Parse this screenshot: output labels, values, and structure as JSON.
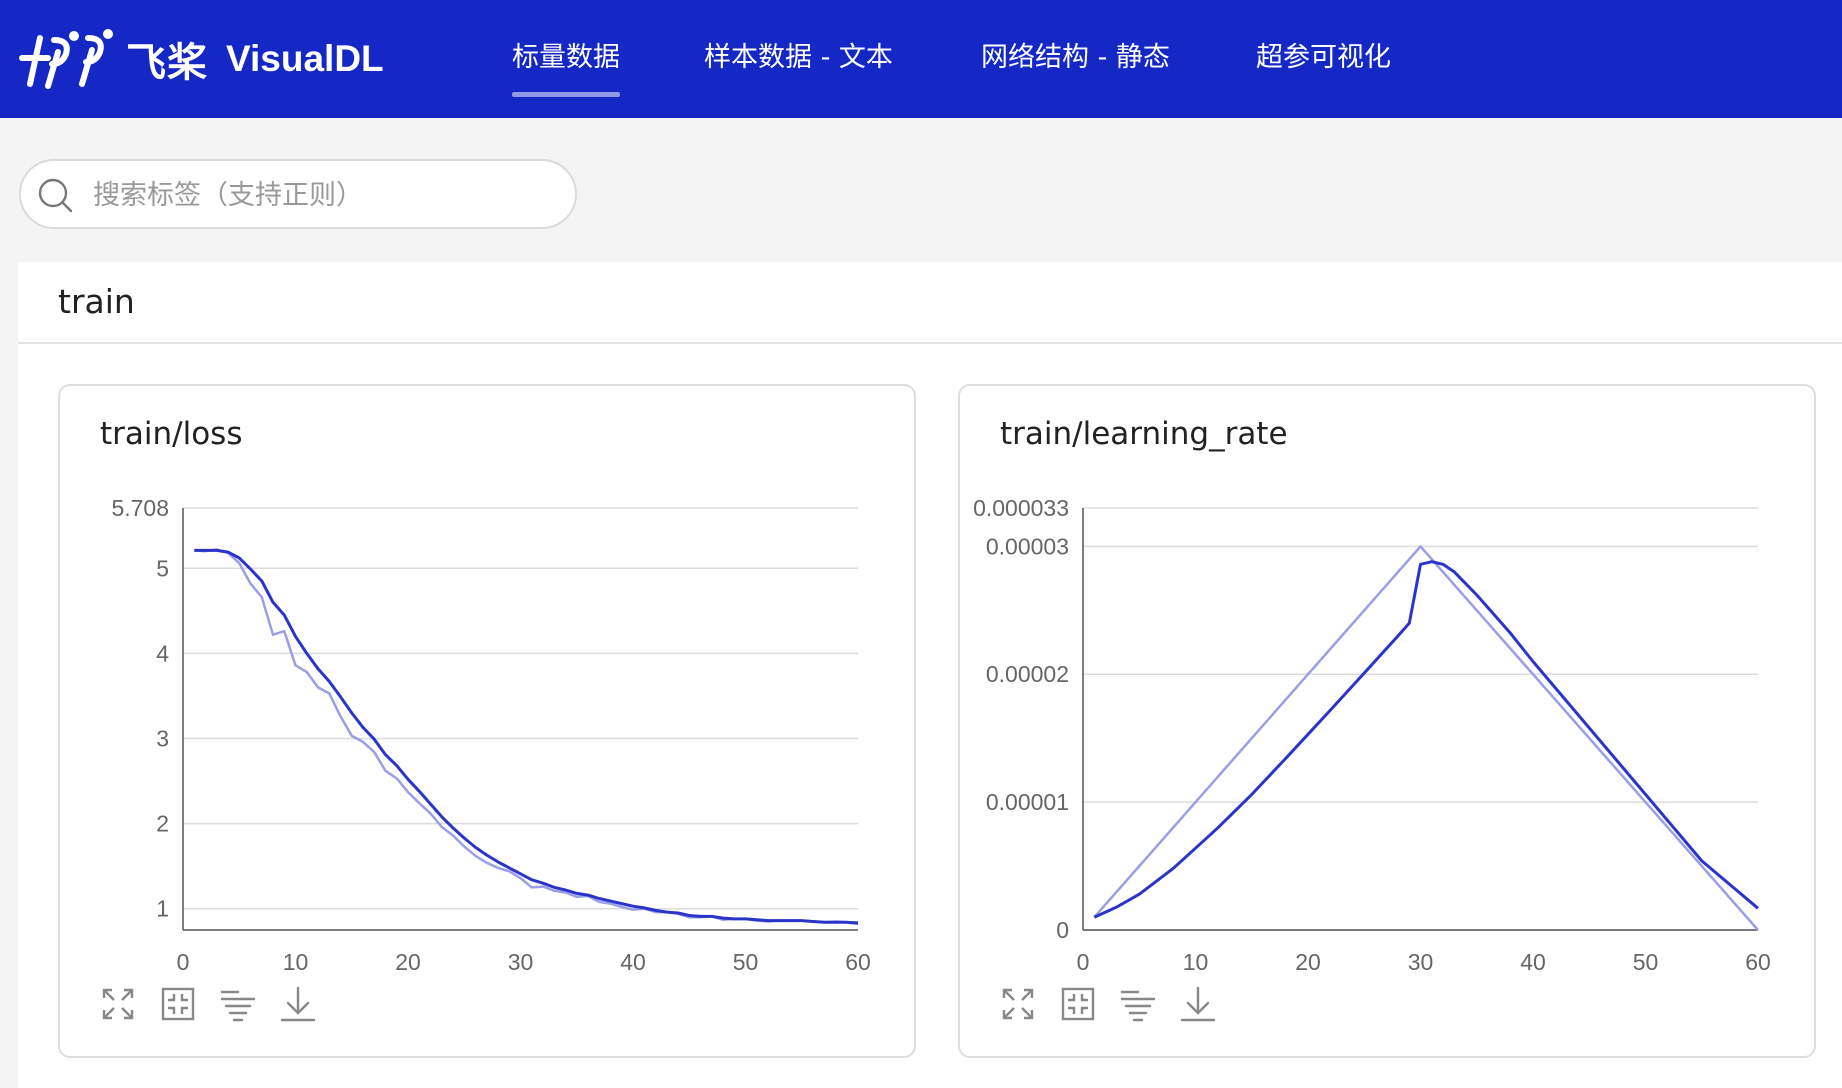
{
  "brand": {
    "name_cn": "飞桨",
    "name_en": "VisualDL"
  },
  "nav": [
    {
      "label": "标量数据",
      "active": true
    },
    {
      "label": "样本数据 - 文本",
      "active": false
    },
    {
      "label": "网络结构 - 静态",
      "active": false
    },
    {
      "label": "超参可视化",
      "active": false
    }
  ],
  "search": {
    "placeholder": "搜索标签（支持正则）",
    "value": ""
  },
  "group": {
    "title": "train"
  },
  "colors": {
    "topbar": "#1527c5",
    "smoothed_line": "#2b34c8",
    "raw_line": "#9a9ee6"
  },
  "chart_data": [
    {
      "type": "line",
      "title": "train/loss",
      "xlabel": "",
      "ylabel": "",
      "xlim": [
        0,
        60
      ],
      "ylim": [
        0.75,
        5.708
      ],
      "x_ticks": [
        "0",
        "10",
        "20",
        "30",
        "40",
        "50",
        "60"
      ],
      "y_ticks": [
        "1",
        "2",
        "3",
        "4",
        "5",
        "5.708"
      ],
      "y_tick_values": [
        1,
        2,
        3,
        4,
        5,
        5.708
      ],
      "grid": true,
      "series": [
        {
          "role": "raw",
          "x": [
            1,
            2,
            3,
            4,
            5,
            6,
            7,
            8,
            9,
            10,
            11,
            12,
            13,
            14,
            15,
            16,
            17,
            18,
            19,
            20,
            21,
            22,
            23,
            24,
            25,
            26,
            27,
            28,
            29,
            30,
            31,
            32,
            33,
            34,
            35,
            36,
            37,
            38,
            39,
            40,
            41,
            42,
            43,
            44,
            45,
            46,
            47,
            48,
            49,
            50,
            51,
            52,
            53,
            54,
            55,
            56,
            57,
            58,
            59,
            60
          ],
          "values": [
            5.21,
            5.2,
            5.22,
            5.18,
            5.06,
            4.82,
            4.66,
            4.22,
            4.26,
            3.86,
            3.78,
            3.6,
            3.53,
            3.26,
            3.03,
            2.96,
            2.84,
            2.62,
            2.53,
            2.37,
            2.24,
            2.12,
            1.96,
            1.86,
            1.73,
            1.62,
            1.54,
            1.48,
            1.44,
            1.36,
            1.25,
            1.26,
            1.21,
            1.19,
            1.14,
            1.15,
            1.08,
            1.06,
            1.02,
            0.99,
            1.0,
            0.96,
            0.96,
            0.94,
            0.9,
            0.9,
            0.91,
            0.87,
            0.88,
            0.88,
            0.86,
            0.85,
            0.86,
            0.86,
            0.86,
            0.85,
            0.84,
            0.85,
            0.84,
            0.84
          ]
        },
        {
          "role": "smoothed",
          "x": [
            1,
            2,
            3,
            4,
            5,
            6,
            7,
            8,
            9,
            10,
            11,
            12,
            13,
            14,
            15,
            16,
            17,
            18,
            19,
            20,
            21,
            22,
            23,
            24,
            25,
            26,
            27,
            28,
            29,
            30,
            31,
            32,
            33,
            34,
            35,
            36,
            37,
            38,
            39,
            40,
            41,
            42,
            43,
            44,
            45,
            46,
            47,
            48,
            49,
            50,
            51,
            52,
            53,
            54,
            55,
            56,
            57,
            58,
            59,
            60
          ],
          "values": [
            5.21,
            5.21,
            5.21,
            5.19,
            5.12,
            4.99,
            4.85,
            4.6,
            4.45,
            4.2,
            4.0,
            3.82,
            3.67,
            3.49,
            3.3,
            3.13,
            2.99,
            2.81,
            2.68,
            2.52,
            2.38,
            2.23,
            2.08,
            1.95,
            1.83,
            1.72,
            1.63,
            1.55,
            1.48,
            1.41,
            1.34,
            1.3,
            1.25,
            1.22,
            1.18,
            1.16,
            1.12,
            1.09,
            1.06,
            1.03,
            1.01,
            0.98,
            0.96,
            0.95,
            0.92,
            0.91,
            0.91,
            0.89,
            0.88,
            0.88,
            0.87,
            0.86,
            0.86,
            0.86,
            0.86,
            0.85,
            0.84,
            0.84,
            0.84,
            0.83
          ]
        }
      ]
    },
    {
      "type": "line",
      "title": "train/learning_rate",
      "xlabel": "",
      "ylabel": "",
      "xlim": [
        0,
        60
      ],
      "ylim": [
        0,
        3.3e-05
      ],
      "x_ticks": [
        "0",
        "10",
        "20",
        "30",
        "40",
        "50",
        "60"
      ],
      "y_ticks": [
        "0",
        "0.00001",
        "0.00002",
        "0.00003",
        "0.000033"
      ],
      "y_tick_values": [
        0,
        1e-05,
        2e-05,
        3e-05,
        3.3e-05
      ],
      "grid": true,
      "series": [
        {
          "role": "raw",
          "x": [
            1,
            30,
            60
          ],
          "values": [
            1e-06,
            3e-05,
            0.0
          ]
        },
        {
          "role": "smoothed",
          "x": [
            1,
            3,
            5,
            8,
            10,
            12,
            15,
            18,
            20,
            22,
            25,
            28,
            29,
            30,
            31,
            32,
            33,
            35,
            38,
            40,
            45,
            50,
            55,
            60
          ],
          "values": [
            1e-06,
            1.8e-06,
            2.8e-06,
            4.8e-06,
            6.4e-06,
            8e-06,
            1.06e-05,
            1.34e-05,
            1.53e-05,
            1.72e-05,
            2.01e-05,
            2.3e-05,
            2.4e-05,
            2.86e-05,
            2.88e-05,
            2.86e-05,
            2.8e-05,
            2.62e-05,
            2.32e-05,
            2.1e-05,
            1.58e-05,
            1.06e-05,
            5.4e-06,
            1.7e-06
          ]
        }
      ]
    }
  ]
}
